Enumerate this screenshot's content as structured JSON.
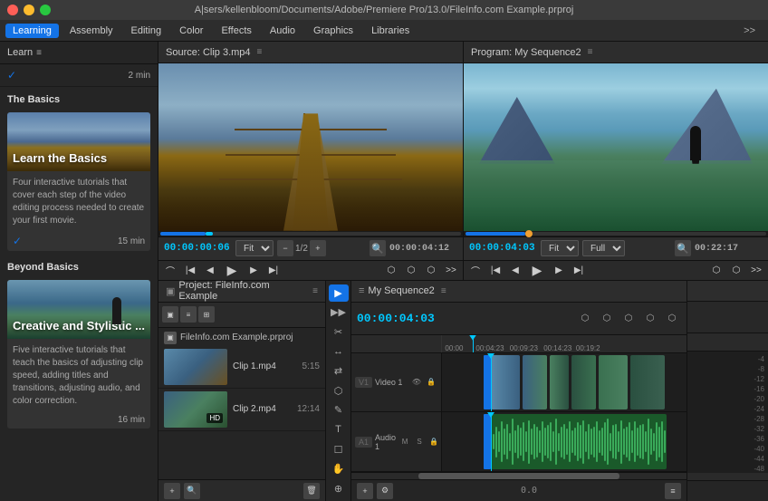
{
  "titleBar": {
    "text": "A|sers/kellenbloom/Documents/Adobe/Premiere Pro/13.0/FileInfo.com Example.prproj",
    "closeBtn": "×",
    "minBtn": "–",
    "maxBtn": "+"
  },
  "menuBar": {
    "items": [
      {
        "label": "Learning",
        "active": true
      },
      {
        "label": "Assembly",
        "active": false
      },
      {
        "label": "Editing",
        "active": false
      },
      {
        "label": "Color",
        "active": false
      },
      {
        "label": "Effects",
        "active": false
      },
      {
        "label": "Audio",
        "active": false
      },
      {
        "label": "Graphics",
        "active": false
      },
      {
        "label": "Libraries",
        "active": false
      }
    ],
    "moreLabel": ">>"
  },
  "leftPanel": {
    "title": "Learn",
    "firstItem": {
      "check": "✓",
      "time": "2 min"
    },
    "sections": [
      {
        "title": "The Basics",
        "card": {
          "label": "Learn the Basics",
          "description": "Four interactive tutorials that cover each step of the video editing process needed to create your first movie.",
          "check": "✓",
          "time": "15 min"
        }
      },
      {
        "title": "Beyond Basics",
        "card": {
          "label": "Creative and Stylistic ...",
          "description": "Five interactive tutorials that teach the basics of adjusting clip speed, adding titles and transitions, adjusting audio, and color correction.",
          "time": "16 min"
        }
      }
    ]
  },
  "sourceMonitor": {
    "title": "Source: Clip 3.mp4",
    "menuIcon": "≡",
    "timecode": "00:00:00:06",
    "fit": "Fit",
    "fraction": "1/2",
    "duration": "00:00:04:12"
  },
  "programMonitor": {
    "title": "Program: My Sequence2",
    "menuIcon": "≡",
    "timecode": "00:00:04:03",
    "fit": "Fit",
    "quality": "Full",
    "duration": "00:22:17"
  },
  "projectPanel": {
    "title": "Project: FileInfo.com Example",
    "menuIcon": "≡",
    "file": "FileInfo.com Example.prproj",
    "clips": [
      {
        "name": "Clip 1.mp4",
        "duration": "5:15"
      },
      {
        "name": "Clip 2.mp4",
        "duration": "12:14"
      }
    ]
  },
  "timeline": {
    "title": "My Sequence2",
    "menuIcon": "≡",
    "timecode": "00:00:04:03",
    "rulerMarks": [
      "00:00",
      "00:04:23",
      "00:09:23",
      "00:14:23",
      "00:19:2"
    ],
    "tracks": [
      {
        "name": "V1",
        "label": "Video 1"
      },
      {
        "name": "A1",
        "label": "Audio 1"
      }
    ],
    "rightRuler": [
      "-4",
      "-8",
      "-12",
      "-16",
      "-20",
      "-24",
      "-28",
      "-32",
      "-36",
      "-40",
      "-44",
      "-48"
    ]
  },
  "tools": {
    "buttons": [
      "▶",
      "✂",
      "↕",
      "⬡",
      "✎",
      "T",
      "☐"
    ]
  }
}
